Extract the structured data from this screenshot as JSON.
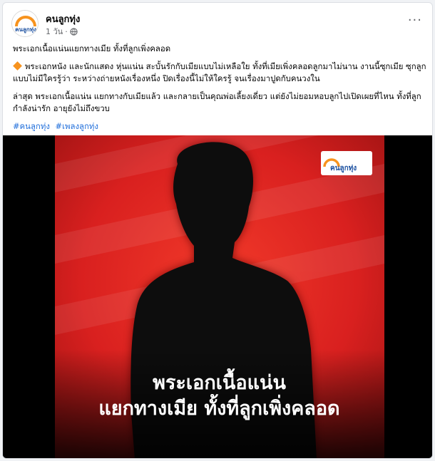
{
  "post": {
    "page_name": "คนลูกทุ่ง",
    "time": "1 วัน",
    "more_icon": "more-options-icon",
    "privacy_icon": "globe-icon",
    "title_line": "พระเอกเนื้อแน่นแยกทางเมีย ทั้งที่ลูกเพิ่งคลอด",
    "paragraph1": "พระเอกหนัง และนักแสดง หุ่นแน่น สะบั้นรักกับเมียแบบไม่เหลือใย ทั้งที่เมียเพิ่งคลอดลูกมาไม่นาน งานนี้ซุกเมีย ซุกลูกแบบไม่มีใครรู้ว่า ระหว่างถ่ายหนังเรื่องหนึ่ง ปิดเรื่องนี้ไม่ให้ใครรู้ จนเรื่องมาปูดกับคนวงใน",
    "paragraph2": "ล่าสุด พระเอกเนื้อแน่น แยกทางกับเมียแล้ว และกลายเป็นคุณพ่อเลี้ยงเดี่ยว แต่ยังไม่ยอมหอบลูกไปเปิดเผยที่ไหน ทั้งที่ลูกกำลังน่ารัก อายุยังไม่ถึงขวบ",
    "hashtags": [
      "#คนลูกทุ่ง",
      "#เพลงลูกทุ่ง"
    ]
  },
  "image": {
    "logo_text": "คนลูกทุ่ง",
    "headline_line1": "พระเอกเนื้อแน่น",
    "headline_line2": "แยกทางเมีย ทั้งที่ลูกเพิ่งคลอด"
  },
  "colors": {
    "accent_red": "#d9201f",
    "link_blue": "#216fdb",
    "brand_orange": "#f7931e"
  }
}
